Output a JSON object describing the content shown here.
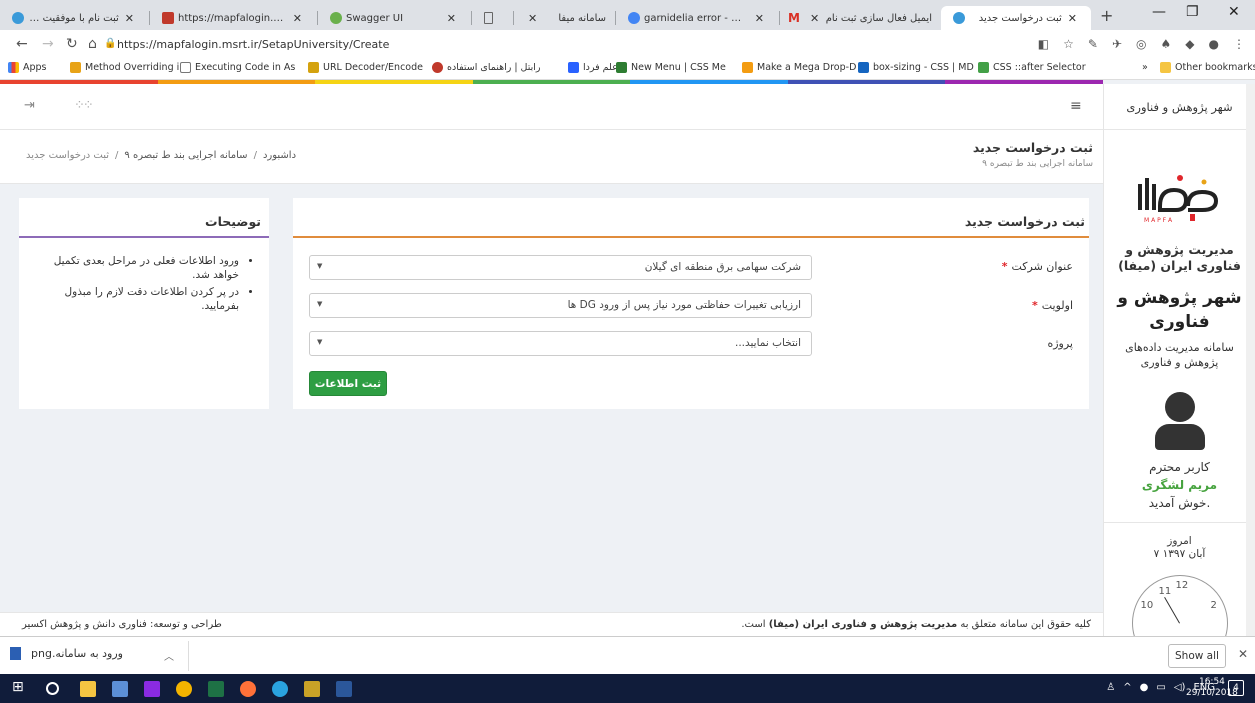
{
  "browser": {
    "tabs": [
      {
        "title": "ثبت نام با موفقیت انجام شد",
        "active": false
      },
      {
        "title": "https://mapfalogin.msrt.ir",
        "active": false
      },
      {
        "title": "Swagger UI",
        "active": false
      },
      {
        "title": "",
        "active": false
      },
      {
        "title": "سامانه میفا",
        "active": false
      },
      {
        "title": "garnidelia error - Google",
        "active": false
      },
      {
        "title": "ایمیل فعال سازی ثبت نام",
        "active": false
      },
      {
        "title": "ثبت درخواست جدید",
        "active": true
      }
    ],
    "url": "https://mapfalogin.msrt.ir/SetapUniversity/Create",
    "bookmarks": [
      "Apps",
      "Method Overriding in",
      "Executing Code in As",
      "URL Decoder/Encode",
      "رابتل | راهنمای استفاده",
      "علم فردا",
      "New Menu | CSS Me",
      "Make a Mega Drop-D",
      "box-sizing - CSS | MD",
      "CSS ::after Selector"
    ],
    "other_bookmarks": "Other bookmarks",
    "more_bookmarks": "»",
    "strip_colors": [
      "#e8432f",
      "#f39c12",
      "#f5d415",
      "#4caf50",
      "#2196f3",
      "#3f51b5",
      "#9c27b0"
    ]
  },
  "sidebar": {
    "top_title": "شهر پژوهش و فناوری",
    "logo_text": "میفا",
    "logo_sub": "M A P F A",
    "org_name": "مدیریت پژوهش و فناوری ایران (میفا)",
    "city_name": "شهر پژوهش و فناوری",
    "system_name": "سامانه مدیریت داده‌های پژوهش و فناوری",
    "greeting": "کاربر محترم",
    "user_name": "مریم لشگری",
    "welcome": "خوش آمدید.",
    "today_label": "امروز",
    "today_date": "۷ آبان ۱۳۹۷",
    "clock_numbers": [
      "12",
      "11",
      "10",
      "2"
    ]
  },
  "page": {
    "title": "ثبت درخواست جدید",
    "subtitle": "سامانه اجرایی بند ط تبصره ۹",
    "breadcrumb": [
      "داشبورد",
      "سامانه اجرایی بند ط تبصره ۹",
      "ثبت درخواست جدید"
    ]
  },
  "form": {
    "title": "ثبت درخواست جدید",
    "fields": [
      {
        "label": "عنوان شرکت",
        "required": true,
        "value": "شرکت سهامی برق منطقه ای گیلان"
      },
      {
        "label": "اولویت",
        "required": true,
        "value": "ارزیابی تغییرات حفاظتی مورد نیاز پس از ورود DG ها"
      },
      {
        "label": "پروژه",
        "required": false,
        "value": "انتخاب نمایید..."
      }
    ],
    "submit_label": "ثبت اطلاعات"
  },
  "description": {
    "title": "توضیحات",
    "items": [
      "ورود اطلاعات فعلی در مراحل بعدی تکمیل خواهد شد.",
      "در پر کردن اطلاعات دقت لازم را مبذول بفرمایید."
    ]
  },
  "footer": {
    "rights_prefix": "کلیه حقوق این سامانه متعلق به",
    "rights_org": "مدیریت پژوهش و فناوری ایران (میفا)",
    "rights_suffix": "است.",
    "credits": "طراحی و توسعه: فناوری دانش و پژوهش اکسیر"
  },
  "downloads": {
    "file_name": "ورود به سامانه.png",
    "show_all": "Show all"
  },
  "taskbar": {
    "lang": "ENG",
    "time": "16:54",
    "date": "29/10/2018",
    "notif_count": "4"
  }
}
